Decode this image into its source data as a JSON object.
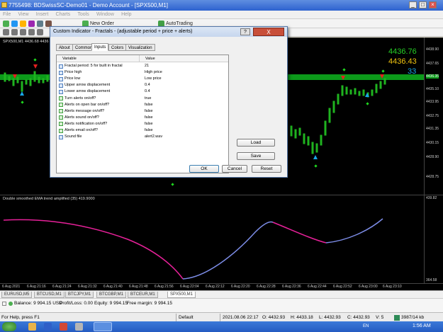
{
  "window": {
    "title": "7755498: BDSwissSC-Demo01 - Demo Account - [SPX500,M1]",
    "minimize": "_",
    "restore": "□",
    "close": "×"
  },
  "menu": [
    "File",
    "View",
    "Insert",
    "Charts",
    "Tools",
    "Window",
    "Help"
  ],
  "toolbar": {
    "new_order": "New Order",
    "autotrading": "AutoTrading"
  },
  "chart": {
    "symbol_label": "SPX500,M1  4436.68 4436",
    "bid": "4436.76",
    "ask": "4436.43",
    "spread": "33",
    "price_ticks": [
      "4438.90",
      "4437.65",
      "4436.35",
      "4435.10",
      "4433.95",
      "4432.75",
      "4431.35",
      "4430.15",
      "4428.90",
      "4428.75"
    ],
    "highlight_price": "4436.35"
  },
  "indicator": {
    "label": "Double smoothed EMA trend amplified (35) 419.9000",
    "top_value": "439.82",
    "bottom_value": "364.58"
  },
  "time_axis": [
    "6 Aug 2021",
    "6 Aug 21:16",
    "6 Aug 21:24",
    "6 Aug 21:32",
    "6 Aug 21:40",
    "6 Aug 21:48",
    "6 Aug 21:56",
    "6 Aug 22:04",
    "6 Aug 22:12",
    "6 Aug 22:20",
    "6 Aug 22:28",
    "6 Aug 22:36",
    "6 Aug 22:44",
    "6 Aug 22:52",
    "6 Aug 23:00",
    "6 Aug 23:10"
  ],
  "symbol_tabs": [
    "EURUSD,M5",
    "BTCUSD,M1",
    "BTCJPY,M1",
    "BTCGBP,M1",
    "BTCEUR,M1",
    "SPX500,M1"
  ],
  "active_tab": "SPX500,M1",
  "trade": {
    "balance": "Balance: 9 994.15 USD",
    "profit": "Profit/Loss: 0.00",
    "equity": "Equity: 9 994.15",
    "free_margin": "Free margin: 9 994.15"
  },
  "status": {
    "help": "For Help, press F1",
    "profile": "Default",
    "datetime": "2021.08.06 22:17",
    "open": "O: 4432.93",
    "high": "H: 4433.18",
    "low": "L: 4432.93",
    "close": "C: 4432.93",
    "volume": "V: 5",
    "traffic": "3987/14 kb"
  },
  "taskbar": {
    "lang": "EN",
    "clock": "1:56 AM"
  },
  "dialog": {
    "title": "Custom Indicator - Fractals - (adjustable period + price + alerts)",
    "help_label": "?",
    "close_label": "X",
    "tabs": [
      "About",
      "Common",
      "Inputs",
      "Colors",
      "Visualization"
    ],
    "active_tab": "Inputs",
    "col_variable": "Variable",
    "col_value": "Value",
    "rows": [
      {
        "label": "Fractal period: 5 for built in fractal",
        "value": "21",
        "icon": "number-icon"
      },
      {
        "label": "Price high",
        "value": "High price",
        "icon": "enum-icon"
      },
      {
        "label": "Price low",
        "value": "Low price",
        "icon": "enum-icon"
      },
      {
        "label": "Upper arrow displacement",
        "value": "0.4",
        "icon": "number-icon"
      },
      {
        "label": "Lower arrow displacement",
        "value": "0.4",
        "icon": "number-icon"
      },
      {
        "label": "Turn alerts on/off?",
        "value": "true",
        "icon": "bool-icon"
      },
      {
        "label": "Alerts on open bar on/off?",
        "value": "false",
        "icon": "bool-icon"
      },
      {
        "label": "Alerts message on/off?",
        "value": "false",
        "icon": "bool-icon"
      },
      {
        "label": "Alerts sound on/off?",
        "value": "false",
        "icon": "bool-icon"
      },
      {
        "label": "Alerts notification on/off?",
        "value": "false",
        "icon": "bool-icon"
      },
      {
        "label": "Alerts email on/off?",
        "value": "false",
        "icon": "bool-icon"
      },
      {
        "label": "Sound file",
        "value": "alert2.wav",
        "icon": "text-icon"
      }
    ],
    "load": "Load",
    "save": "Save",
    "ok": "OK",
    "cancel": "Cancel",
    "reset": "Reset"
  }
}
